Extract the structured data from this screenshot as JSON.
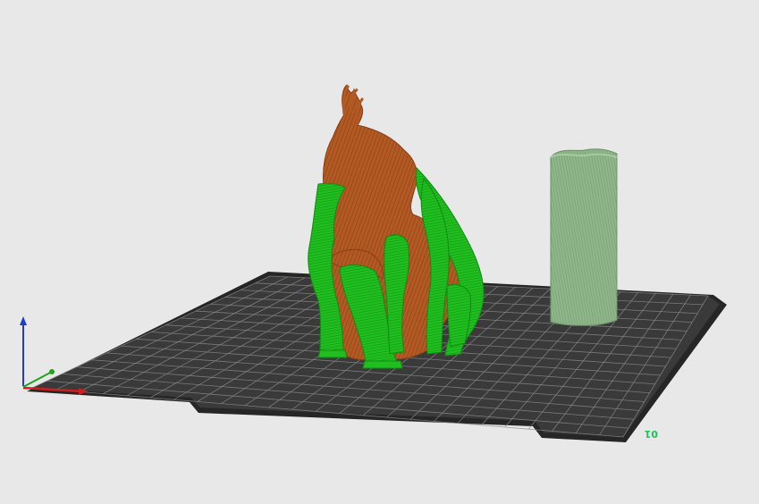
{
  "viewport": {
    "background": "#e8e8e8"
  },
  "bed": {
    "surface_color": "#3a3a3a",
    "edge_color": "#262626",
    "grid_color": "#8a8a8a",
    "label": "01",
    "label_color": "#22c05a"
  },
  "models": {
    "figure": {
      "color": "#b35a24",
      "shade_color": "#8a3f14"
    },
    "supports": {
      "color": "#1fbf1f",
      "shade_color": "#138a13"
    },
    "wipe_tower": {
      "color": "#8fb58a",
      "shade_color": "#6d9468"
    }
  },
  "axes": {
    "x_color": "#d11e1e",
    "y_color": "#1ea51e",
    "z_color": "#1e3cd1"
  },
  "icons": {
    "axes": "axis-gizmo-icon"
  }
}
